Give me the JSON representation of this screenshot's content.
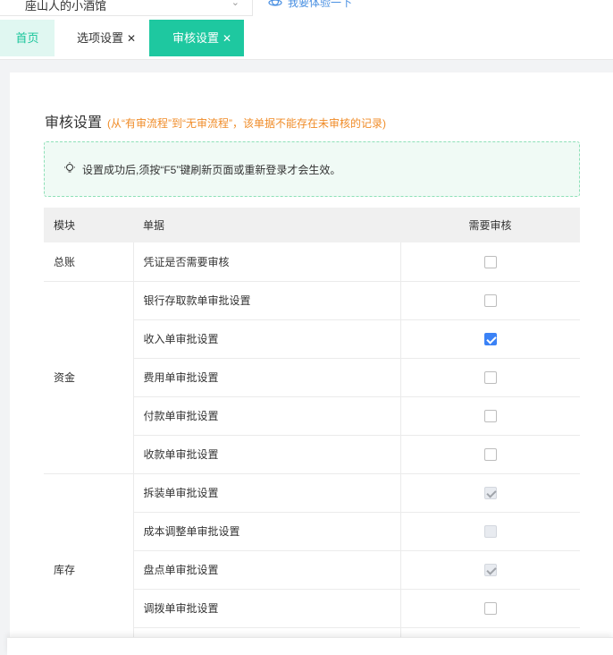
{
  "topbar": {
    "shop_name": "座山人的小酒馆",
    "demo_link": "我要体验一下"
  },
  "tabs": [
    {
      "label": "首页",
      "active": false,
      "closable": false
    },
    {
      "label": "选项设置",
      "active": false,
      "closable": true
    },
    {
      "label": "审核设置",
      "active": true,
      "closable": true
    }
  ],
  "page": {
    "title": "审核设置",
    "note": "(从“有审流程”到“无审流程”，该单据不能存在未审核的记录)",
    "tip": "设置成功后,须按“F5”键刷新页面或重新登录才会生效。"
  },
  "table": {
    "headers": [
      "模块",
      "单据",
      "需要审核"
    ],
    "groups": [
      {
        "module": "总账",
        "rows": [
          {
            "doc": "凭证是否需要审核",
            "checked": false,
            "disabled": false
          }
        ]
      },
      {
        "module": "资金",
        "rows": [
          {
            "doc": "银行存取款单审批设置",
            "checked": false,
            "disabled": false
          },
          {
            "doc": "收入单审批设置",
            "checked": true,
            "disabled": false
          },
          {
            "doc": "费用单审批设置",
            "checked": false,
            "disabled": false
          },
          {
            "doc": "付款单审批设置",
            "checked": false,
            "disabled": false
          },
          {
            "doc": "收款单审批设置",
            "checked": false,
            "disabled": false
          }
        ]
      },
      {
        "module": "库存",
        "rows": [
          {
            "doc": "拆装单审批设置",
            "checked": true,
            "disabled": true
          },
          {
            "doc": "成本调整单审批设置",
            "checked": false,
            "disabled": true
          },
          {
            "doc": "盘点单审批设置",
            "checked": true,
            "disabled": true
          },
          {
            "doc": "调拨单审批设置",
            "checked": false,
            "disabled": false
          },
          {
            "doc": "",
            "checked": false,
            "disabled": false
          }
        ]
      }
    ]
  },
  "colors": {
    "accent": "#1ec8a0",
    "note": "#f08c28",
    "checkbox_blue": "#3b82f6"
  }
}
